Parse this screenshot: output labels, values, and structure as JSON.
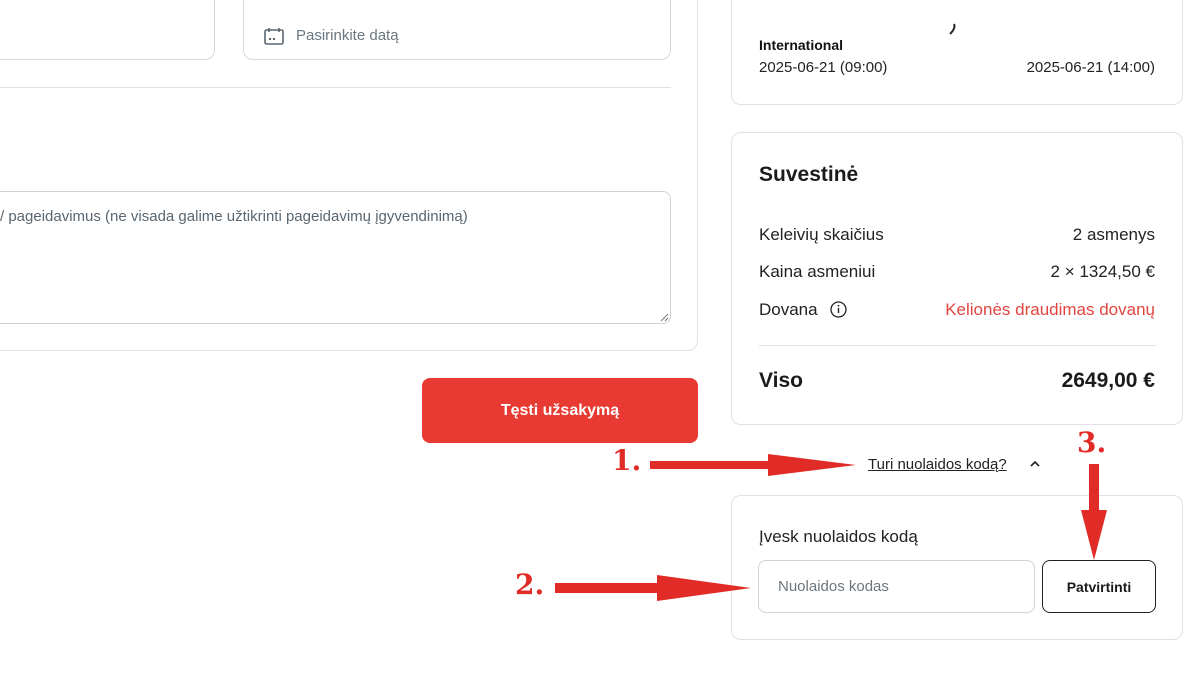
{
  "form": {
    "date_placeholder": "Pasirinkite datą",
    "wishes_placeholder": "/ pageidavimus (ne visada galime užtikrinti pageidavimų įgyvendinimą)",
    "continue_button": "Tęsti užsakymą"
  },
  "trip": {
    "operator": "International",
    "departure": "2025-06-21 (09:00)",
    "arrival": "2025-06-21 (14:00)"
  },
  "summary": {
    "title": "Suvestinė",
    "rows": [
      {
        "label": "Keleivių skaičius",
        "value": "2 asmenys"
      },
      {
        "label": "Kaina asmeniui",
        "value": "2 × 1324,50 €"
      },
      {
        "label": "Dovana",
        "value": "Kelionės draudimas dovanų"
      }
    ],
    "total_label": "Viso",
    "total_value": "2649,00 €",
    "gift_color": "#e1453f"
  },
  "discount": {
    "toggle_label": "Turi nuolaidos kodą?",
    "title": "Įvesk nuolaidos kodą",
    "input_placeholder": "Nuolaidos kodas",
    "confirm_button": "Patvirtinti"
  },
  "annotations": {
    "step1": "1.",
    "step2": "2.",
    "step3": "3.",
    "color": "#e12b26"
  },
  "icons": {
    "calendar": "calendar-icon",
    "info": "info-icon",
    "chevron": "chevron-up-icon"
  }
}
